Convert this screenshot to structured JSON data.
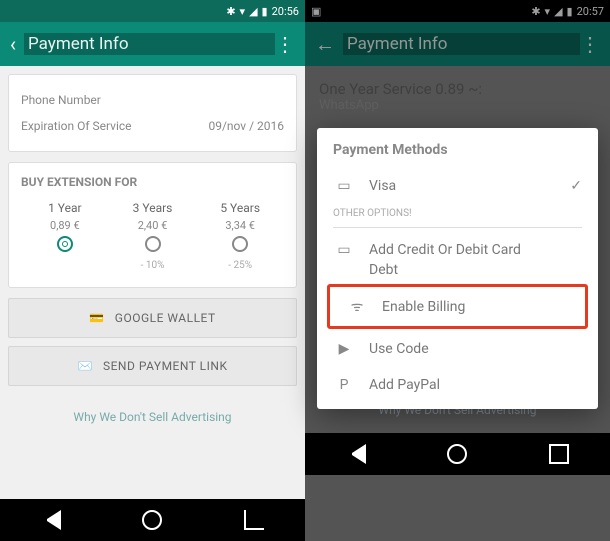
{
  "left": {
    "status_time": "20:56",
    "title": "Payment Info",
    "phone_label": "Phone Number",
    "expiration_label": "Expiration Of Service",
    "expiration_value": "09/nov / 2016",
    "buy_label": "BUY EXTENSION FOR",
    "plans": {
      "p1": {
        "years": "1 Year",
        "price": "0,89 €",
        "disc": ""
      },
      "p3": {
        "years": "3 Years",
        "price": "2,40 €",
        "disc": "- 10%"
      },
      "p5": {
        "years": "5 Years",
        "price": "3,34 €",
        "disc": "- 25%"
      }
    },
    "wallet_btn": "GOOGLE WALLET",
    "link_btn": "SEND PAYMENT LINK",
    "ads_link": "Why We Don't Sell Advertising"
  },
  "right": {
    "status_time": "20:57",
    "title": "Payment Info",
    "service_line": "One Year Service 0.89 ~:",
    "service_sub": "WhatsApp",
    "dialog_title": "Payment Methods",
    "visa": "Visa",
    "other_label": "OTHER OPTIONS!",
    "add_card": "Add Credit Or Debit Card",
    "add_card_sub": "Debt",
    "enable_billing": "Enable Billing",
    "use_code": "Use Code",
    "add_paypal": "Add PayPal",
    "ads_link": "Why We Don't Sell Advertising"
  }
}
